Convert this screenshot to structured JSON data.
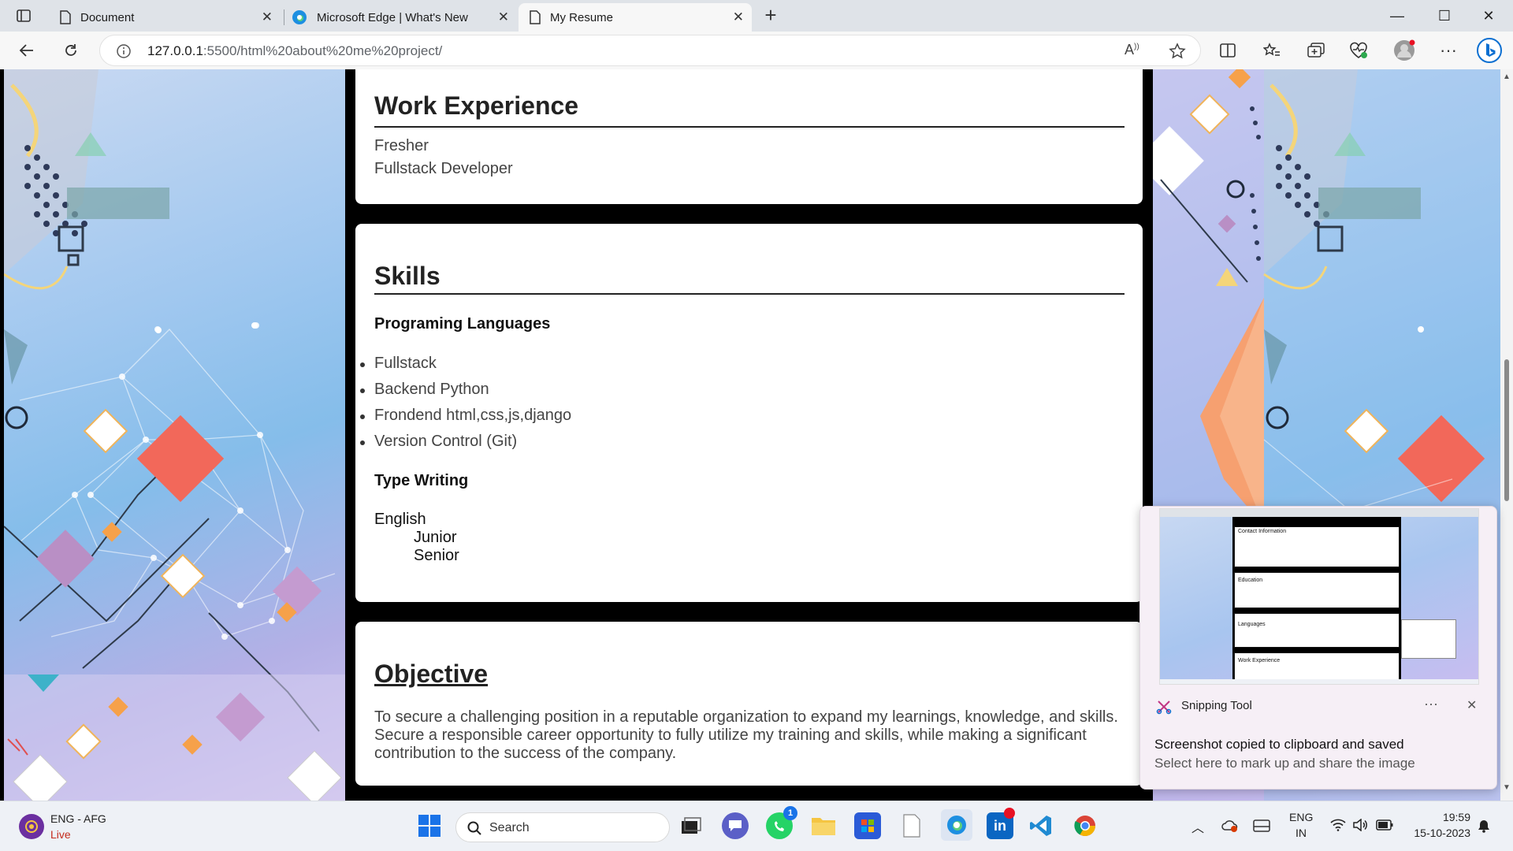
{
  "browser": {
    "tabs": [
      {
        "title": "Document",
        "active": false
      },
      {
        "title": "Microsoft Edge | What's New",
        "active": false
      },
      {
        "title": "My Resume",
        "active": true
      }
    ],
    "new_tab": "+",
    "window_controls": {
      "minimize": "—",
      "maximize": "☐",
      "close": "✕"
    },
    "address": {
      "host": "127.0.0.1",
      "rest": ":5500/html%20about%20me%20project/"
    }
  },
  "resume": {
    "work_experience": {
      "heading": "Work Experience",
      "lines": [
        "Fresher",
        "Fullstack Developer"
      ]
    },
    "skills": {
      "heading": "Skills",
      "programming_heading": "Programing Languages",
      "programming_items": [
        "Fullstack",
        "Backend Python",
        "Frondend html,css,js,django",
        "Version Control (Git)"
      ],
      "typing_heading": "Type Writing",
      "typing_language": "English",
      "typing_levels": [
        "Junior",
        "Senior"
      ]
    },
    "objective": {
      "heading": "Objective",
      "text": "To secure a challenging position in a reputable organization to expand my learnings, knowledge, and skills. Secure a responsible career opportunity to fully utilize my training and skills, while making a significant contribution to the success of the company."
    }
  },
  "toast": {
    "app_name": "Snipping Tool",
    "more": "···",
    "close": "✕",
    "title": "Screenshot copied to clipboard and saved",
    "subtitle": "Select here to mark up and share the image",
    "thumbnail_labels": [
      "Contact Information",
      "Education",
      "Languages",
      "Work Experience"
    ]
  },
  "taskbar": {
    "weather_lang": "ENG - AFG",
    "weather_status": "Live",
    "search_placeholder": "Search",
    "whatsapp_badge": "1",
    "input_lang_top": "ENG",
    "input_lang_bottom": "IN",
    "time": "19:59",
    "date": "15-10-2023"
  }
}
